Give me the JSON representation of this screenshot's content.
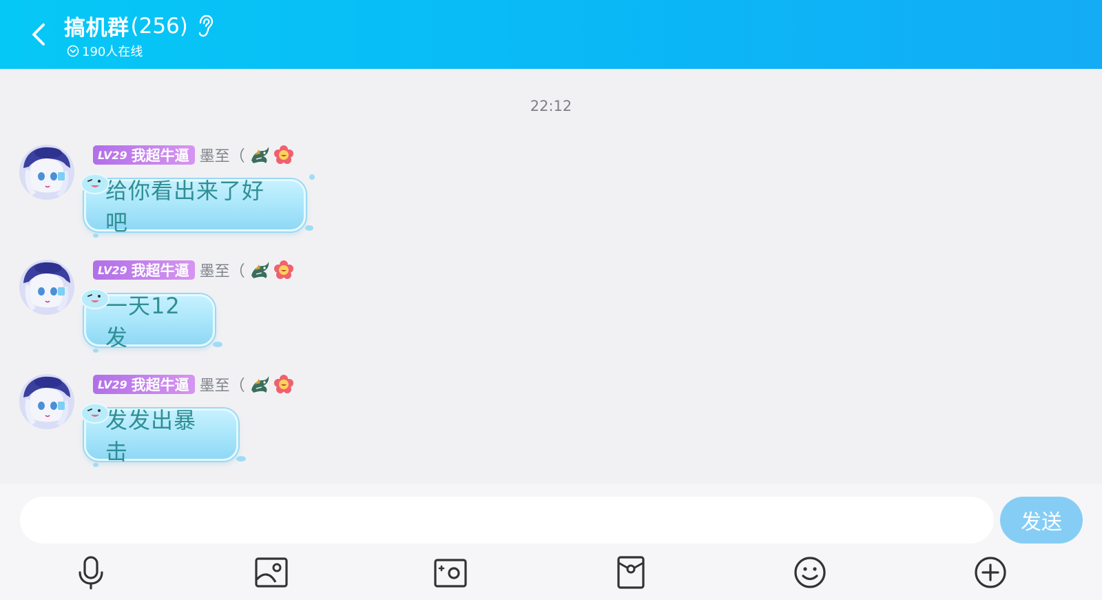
{
  "header": {
    "title": "搞机群",
    "member_count": "(256)",
    "online_text": "190人在线"
  },
  "chat": {
    "timestamp": "22:12",
    "messages": [
      {
        "level": "LV29",
        "title": "我超牛逼",
        "nickname": "墨至（",
        "text": "给你看出来了好吧"
      },
      {
        "level": "LV29",
        "title": "我超牛逼",
        "nickname": "墨至（",
        "text": "一天12发"
      },
      {
        "level": "LV29",
        "title": "我超牛逼",
        "nickname": "墨至（",
        "text": "发发出暴击"
      }
    ]
  },
  "input": {
    "placeholder": "",
    "send_label": "发送"
  },
  "toolbar": [
    "microphone-icon",
    "image-icon",
    "camera-icon",
    "red-packet-icon",
    "emoji-icon",
    "plus-icon"
  ],
  "colors": {
    "header": "#0ab8f6",
    "level_badge": "#c07fec",
    "bubble": "#a7e5fa",
    "bubble_text": "#2f8f94",
    "send_button": "#86cdf5"
  }
}
